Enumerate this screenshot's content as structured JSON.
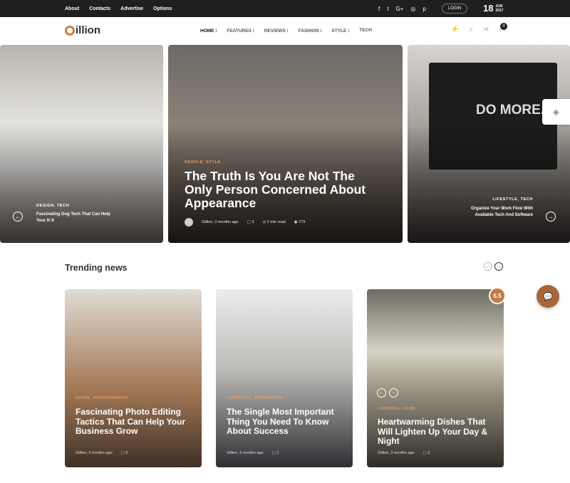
{
  "topbar": {
    "links": [
      "About",
      "Contacts",
      "Advertise",
      "Options"
    ],
    "social_icons": [
      {
        "name": "facebook-icon",
        "glyph": "f"
      },
      {
        "name": "twitter-icon",
        "glyph": "t"
      },
      {
        "name": "google-plus-icon",
        "glyph": "G+"
      },
      {
        "name": "instagram-icon",
        "glyph": "◎"
      },
      {
        "name": "pinterest-icon",
        "glyph": "p"
      }
    ],
    "login_label": "LOGIN",
    "date_day": "18",
    "date_month": "JUN",
    "date_year": "2017"
  },
  "header": {
    "logo_text": "illion",
    "nav": [
      "HOME ⁝",
      "FEATURES ⁝",
      "REVIEWS ⁝",
      "FASHION ⁝",
      "STYLE ⁝",
      "TECH"
    ],
    "cart_count": "0",
    "accent_color": "#c7803f"
  },
  "hero": {
    "slide1": {
      "category": "DESIGN, TECH",
      "title": "Fascinating Dog Tech That Can Help Your K-9"
    },
    "slide2": {
      "category": "PEOPLE, STYLE",
      "title": "The Truth Is You Are Not The Only Person Concerned About Appearance",
      "author": "Gillion, 3 months ago",
      "comments": "3",
      "read_time": "2 min read",
      "views": "773"
    },
    "slide3": {
      "category": "LIFESTYLE, TECH",
      "title": "Organize Your Work Flow With Available Tech And Software",
      "screen_text": "DO MORE."
    }
  },
  "trending": {
    "title": "Trending news",
    "cards": [
      {
        "category": "GUIDE, PHOTOGRAPHY",
        "title": "Fascinating Photo Editing Tactics That Can Help Your Business Grow",
        "author": "Gillion, 3 months ago",
        "comments": "0"
      },
      {
        "category": "LIFESTYLE, MOTIVATION",
        "title": "The Single Most Important Thing You Need To Know About Success",
        "author": "Gillion, 6 months ago",
        "comments": "1"
      },
      {
        "category": "COOKING, FOOD",
        "title": "Heartwarming Dishes That Will Lighten Up Your Day & Night",
        "author": "Gillion, 3 months ago",
        "comments": "2",
        "rating": "6.5"
      }
    ]
  }
}
